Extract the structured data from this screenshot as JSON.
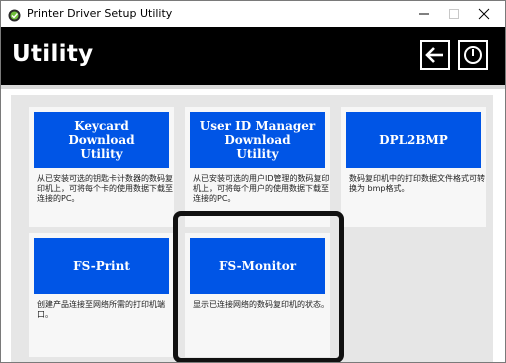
{
  "window": {
    "title": "Printer Driver Setup Utility",
    "controls": {
      "minimize": "–",
      "maximize": "□",
      "close": "✕"
    }
  },
  "header": {
    "title": "Utility",
    "back_icon": "arrow-left-icon",
    "exit_icon": "power-icon"
  },
  "colors": {
    "tile_button": "#0055e6",
    "header_bg": "#000000",
    "panel_bg": "#e6e6e6"
  },
  "tiles": [
    {
      "label": "Keycard\nDownload\nUtility",
      "desc": "从已安装可选的钥匙卡计数器的数码复印机上，可将每个卡的使用数据下载至连接的PC。"
    },
    {
      "label": "User ID Manager\nDownload\nUtility",
      "desc": "从已安装可选的用户ID管理的数码复印机上，可将每个用户的使用数据下载至连接的PC。"
    },
    {
      "label": "DPL2BMP",
      "desc": "数码复印机中的打印数据文件格式可转换为 bmp格式。"
    },
    {
      "label": "FS-Print",
      "desc": "创建产品连接至网络所需的打印机端口。"
    },
    {
      "label": "FS-Monitor",
      "desc": "显示已连接网络的数码复印机的状态。"
    }
  ]
}
